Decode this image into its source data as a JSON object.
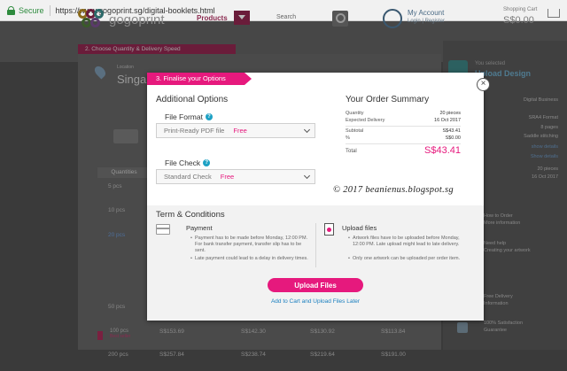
{
  "browser": {
    "secure_label": "Secure",
    "url": "https://www.gogoprint.sg/digital-booklets.html"
  },
  "header": {
    "logo_text": "gogoprint",
    "products_label": "Products",
    "search_placeholder": "Search",
    "account_title": "My Account",
    "account_links": "Login | Register",
    "cart_label": "Shopping Cart",
    "cart_value": "S$0.00"
  },
  "steps": {
    "step2": "2. Choose Quantity & Delivery Speed",
    "step3": "3. Finalise your Options"
  },
  "background": {
    "location_label": "Location",
    "location_value": "Singap",
    "quantities_header": "Quantities",
    "quantities": [
      "5 pcs",
      "10 pcs",
      "20 pcs",
      "50 pcs",
      "100 pcs",
      "200 pcs"
    ],
    "bestseller_qty": "100 pcs",
    "bestseller_tag": "Best seller",
    "last_qty": "200 pcs",
    "prices_row1": [
      "S$153.69",
      "S$142.30",
      "S$130.92",
      "S$113.84"
    ],
    "prices_row2": [
      "S$257.84",
      "S$238.74",
      "S$219.64",
      "S$191.00"
    ]
  },
  "right_panel": {
    "small_label": "You selected",
    "title": "Upload Design",
    "details": [
      "Digital Business",
      "",
      "SRA4 Format",
      "8 pages",
      "Saddle stitching",
      "show details",
      "Show details",
      "20 pieces",
      "16 Oct 2017"
    ],
    "side_items": [
      "How to Order",
      "More information",
      "Need help",
      "Creating your artwork",
      "Free Delivery",
      "Information",
      "100% Satisfaction",
      "Guarantee"
    ]
  },
  "modal": {
    "close_label": "×",
    "additional_title": "Additional Options",
    "file_format": {
      "label": "File Format",
      "help": "?",
      "value": "Print-Ready PDF file",
      "price": "Free"
    },
    "file_check": {
      "label": "File Check",
      "help": "?",
      "value": "Standard Check",
      "price": "Free"
    },
    "summary": {
      "title": "Your Order Summary",
      "rows": [
        {
          "label": "Quantity",
          "value": "20 pieces"
        },
        {
          "label": "Expected Delivery",
          "value": "16 Oct 2017"
        },
        {
          "label": "Subtotal",
          "value": "S$43.41"
        },
        {
          "label": "%",
          "value": "S$0.00"
        }
      ],
      "total_label": "Total",
      "total_value": "S$43.41"
    },
    "watermark": "© 2017 beanienus.blogspot.sg",
    "terms": {
      "title": "Term & Conditions",
      "payment": {
        "title": "Payment",
        "bullets": [
          "Payment has to be made before Monday, 12:00 PM. For bank transfer payment, transfer slip has to be sent.",
          "Late payment could lead to a delay in delivery times."
        ]
      },
      "upload": {
        "title": "Upload files",
        "bullets": [
          "Artwork files have to be uploaded before Monday, 12:00 PM. Late upload might lead to late delivery.",
          "Only one artwork can be uploaded per order item."
        ]
      }
    },
    "upload_button": "Upload Files",
    "later_link": "Add to Cart and Upload Files Later"
  },
  "colors": {
    "brand_pink": "#e6197d",
    "link_blue": "#1a7fbf",
    "help_blue": "#1da1c4"
  }
}
